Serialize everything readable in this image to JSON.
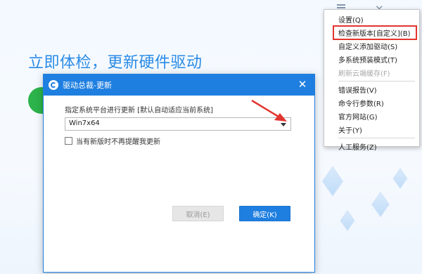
{
  "background": {
    "heading": "立即体检，更新硬件驱动",
    "menu_icon": "hamburger-icon",
    "close_icon": "close-icon"
  },
  "dialog": {
    "title": "驱动总裁-更新",
    "logo_icon": "app-logo-icon",
    "close_icon": "close-icon",
    "platform_label": "指定系统平台进行更新 [默认自动适应当前系统]",
    "platform_select": {
      "value": "Win7x64"
    },
    "dont_remind_label": "当有新版时不再提醒我更新",
    "dont_remind_checked": false,
    "cancel_label": "取消(E)",
    "ok_label": "确定(K)"
  },
  "context_menu": {
    "items": [
      {
        "label": "设置(Q)",
        "disabled": false,
        "highlight": false
      },
      {
        "label": "检查新版本[自定义](B)",
        "disabled": false,
        "highlight": true
      },
      {
        "label": "自定义添加驱动(S)",
        "disabled": false,
        "highlight": false
      },
      {
        "label": "多系统预装模式(T)",
        "disabled": false,
        "highlight": false
      },
      {
        "label": "刷新云端缓存(F)",
        "disabled": true,
        "highlight": false
      },
      {
        "label": "错误报告(V)",
        "disabled": false,
        "highlight": false
      },
      {
        "label": "命令行参数(R)",
        "disabled": false,
        "highlight": false
      },
      {
        "label": "官方网站(G)",
        "disabled": false,
        "highlight": false
      },
      {
        "label": "关于(Y)",
        "disabled": false,
        "highlight": false
      },
      {
        "label": "人工服务(Z)",
        "disabled": false,
        "highlight": false
      }
    ]
  },
  "colors": {
    "accent": "#1f7fe0",
    "heading": "#2a8be6",
    "highlight_border": "#e2352f",
    "annotation_arrow": "#e2352f"
  }
}
